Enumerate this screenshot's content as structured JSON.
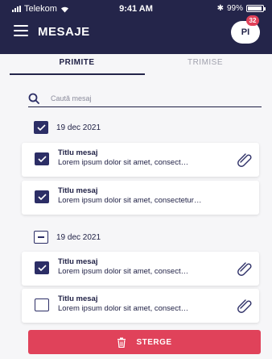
{
  "status_bar": {
    "carrier": "Telekom",
    "time": "9:41 AM",
    "bluetooth": "✱",
    "battery": "99%"
  },
  "header": {
    "title": "MESAJE",
    "avatar_initials": "PI",
    "notification_count": "32"
  },
  "tabs": [
    {
      "label": "PRIMITE",
      "active": true
    },
    {
      "label": "TRIMISE",
      "active": false
    }
  ],
  "search": {
    "placeholder": "Caută mesaj"
  },
  "groups": [
    {
      "date": "19 dec 2021",
      "state": "checked",
      "messages": [
        {
          "title": "Titlu mesaj",
          "body": "Lorem ipsum dolor sit amet, consect…",
          "checked": true,
          "attachment": true
        },
        {
          "title": "Titlu mesaj",
          "body": "Lorem ipsum dolor sit amet, consectetur…",
          "checked": true,
          "attachment": false
        }
      ]
    },
    {
      "date": "19 dec 2021",
      "state": "partial",
      "messages": [
        {
          "title": "Titlu mesaj",
          "body": "Lorem ipsum dolor sit amet, consect…",
          "checked": true,
          "attachment": true
        },
        {
          "title": "Titlu mesaj",
          "body": "Lorem ipsum dolor sit amet, consect…",
          "checked": false,
          "attachment": true
        }
      ]
    }
  ],
  "delete_button": {
    "label": "STERGE"
  },
  "colors": {
    "header_bg": "#24254a",
    "accent": "#2c2e66",
    "danger": "#e0425a",
    "background": "#f6f6f8"
  },
  "icons": {
    "menu": "hamburger-icon",
    "search": "search-icon",
    "attachment": "paperclip-icon",
    "delete": "trash-icon",
    "check": "checkmark-icon"
  }
}
